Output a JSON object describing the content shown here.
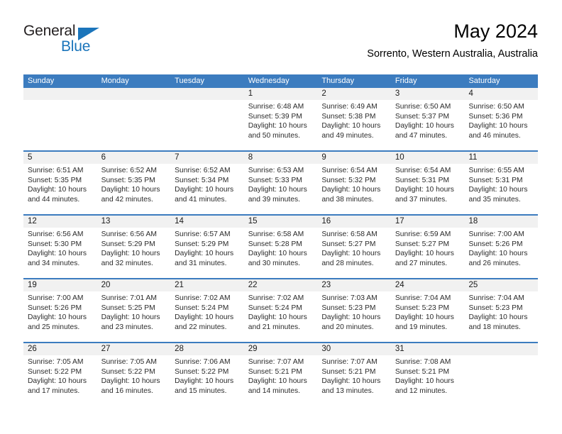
{
  "brand": {
    "name_part1": "General",
    "name_part2": "Blue",
    "triangle_color": "#1b75bb"
  },
  "header": {
    "title": "May 2024",
    "subtitle": "Sorrento, Western Australia, Australia"
  },
  "theme": {
    "header_blue": "#3c7cbf",
    "band_gray": "#f1f1f1",
    "text": "#2b2b2b"
  },
  "weekdays": [
    "Sunday",
    "Monday",
    "Tuesday",
    "Wednesday",
    "Thursday",
    "Friday",
    "Saturday"
  ],
  "weeks": [
    {
      "days": [
        {
          "num": "",
          "sunrise": "",
          "sunset": "",
          "daylight_line1": "",
          "daylight_line2": ""
        },
        {
          "num": "",
          "sunrise": "",
          "sunset": "",
          "daylight_line1": "",
          "daylight_line2": ""
        },
        {
          "num": "",
          "sunrise": "",
          "sunset": "",
          "daylight_line1": "",
          "daylight_line2": ""
        },
        {
          "num": "1",
          "sunrise": "Sunrise: 6:48 AM",
          "sunset": "Sunset: 5:39 PM",
          "daylight_line1": "Daylight: 10 hours",
          "daylight_line2": "and 50 minutes."
        },
        {
          "num": "2",
          "sunrise": "Sunrise: 6:49 AM",
          "sunset": "Sunset: 5:38 PM",
          "daylight_line1": "Daylight: 10 hours",
          "daylight_line2": "and 49 minutes."
        },
        {
          "num": "3",
          "sunrise": "Sunrise: 6:50 AM",
          "sunset": "Sunset: 5:37 PM",
          "daylight_line1": "Daylight: 10 hours",
          "daylight_line2": "and 47 minutes."
        },
        {
          "num": "4",
          "sunrise": "Sunrise: 6:50 AM",
          "sunset": "Sunset: 5:36 PM",
          "daylight_line1": "Daylight: 10 hours",
          "daylight_line2": "and 46 minutes."
        }
      ]
    },
    {
      "days": [
        {
          "num": "5",
          "sunrise": "Sunrise: 6:51 AM",
          "sunset": "Sunset: 5:35 PM",
          "daylight_line1": "Daylight: 10 hours",
          "daylight_line2": "and 44 minutes."
        },
        {
          "num": "6",
          "sunrise": "Sunrise: 6:52 AM",
          "sunset": "Sunset: 5:35 PM",
          "daylight_line1": "Daylight: 10 hours",
          "daylight_line2": "and 42 minutes."
        },
        {
          "num": "7",
          "sunrise": "Sunrise: 6:52 AM",
          "sunset": "Sunset: 5:34 PM",
          "daylight_line1": "Daylight: 10 hours",
          "daylight_line2": "and 41 minutes."
        },
        {
          "num": "8",
          "sunrise": "Sunrise: 6:53 AM",
          "sunset": "Sunset: 5:33 PM",
          "daylight_line1": "Daylight: 10 hours",
          "daylight_line2": "and 39 minutes."
        },
        {
          "num": "9",
          "sunrise": "Sunrise: 6:54 AM",
          "sunset": "Sunset: 5:32 PM",
          "daylight_line1": "Daylight: 10 hours",
          "daylight_line2": "and 38 minutes."
        },
        {
          "num": "10",
          "sunrise": "Sunrise: 6:54 AM",
          "sunset": "Sunset: 5:31 PM",
          "daylight_line1": "Daylight: 10 hours",
          "daylight_line2": "and 37 minutes."
        },
        {
          "num": "11",
          "sunrise": "Sunrise: 6:55 AM",
          "sunset": "Sunset: 5:31 PM",
          "daylight_line1": "Daylight: 10 hours",
          "daylight_line2": "and 35 minutes."
        }
      ]
    },
    {
      "days": [
        {
          "num": "12",
          "sunrise": "Sunrise: 6:56 AM",
          "sunset": "Sunset: 5:30 PM",
          "daylight_line1": "Daylight: 10 hours",
          "daylight_line2": "and 34 minutes."
        },
        {
          "num": "13",
          "sunrise": "Sunrise: 6:56 AM",
          "sunset": "Sunset: 5:29 PM",
          "daylight_line1": "Daylight: 10 hours",
          "daylight_line2": "and 32 minutes."
        },
        {
          "num": "14",
          "sunrise": "Sunrise: 6:57 AM",
          "sunset": "Sunset: 5:29 PM",
          "daylight_line1": "Daylight: 10 hours",
          "daylight_line2": "and 31 minutes."
        },
        {
          "num": "15",
          "sunrise": "Sunrise: 6:58 AM",
          "sunset": "Sunset: 5:28 PM",
          "daylight_line1": "Daylight: 10 hours",
          "daylight_line2": "and 30 minutes."
        },
        {
          "num": "16",
          "sunrise": "Sunrise: 6:58 AM",
          "sunset": "Sunset: 5:27 PM",
          "daylight_line1": "Daylight: 10 hours",
          "daylight_line2": "and 28 minutes."
        },
        {
          "num": "17",
          "sunrise": "Sunrise: 6:59 AM",
          "sunset": "Sunset: 5:27 PM",
          "daylight_line1": "Daylight: 10 hours",
          "daylight_line2": "and 27 minutes."
        },
        {
          "num": "18",
          "sunrise": "Sunrise: 7:00 AM",
          "sunset": "Sunset: 5:26 PM",
          "daylight_line1": "Daylight: 10 hours",
          "daylight_line2": "and 26 minutes."
        }
      ]
    },
    {
      "days": [
        {
          "num": "19",
          "sunrise": "Sunrise: 7:00 AM",
          "sunset": "Sunset: 5:26 PM",
          "daylight_line1": "Daylight: 10 hours",
          "daylight_line2": "and 25 minutes."
        },
        {
          "num": "20",
          "sunrise": "Sunrise: 7:01 AM",
          "sunset": "Sunset: 5:25 PM",
          "daylight_line1": "Daylight: 10 hours",
          "daylight_line2": "and 23 minutes."
        },
        {
          "num": "21",
          "sunrise": "Sunrise: 7:02 AM",
          "sunset": "Sunset: 5:24 PM",
          "daylight_line1": "Daylight: 10 hours",
          "daylight_line2": "and 22 minutes."
        },
        {
          "num": "22",
          "sunrise": "Sunrise: 7:02 AM",
          "sunset": "Sunset: 5:24 PM",
          "daylight_line1": "Daylight: 10 hours",
          "daylight_line2": "and 21 minutes."
        },
        {
          "num": "23",
          "sunrise": "Sunrise: 7:03 AM",
          "sunset": "Sunset: 5:23 PM",
          "daylight_line1": "Daylight: 10 hours",
          "daylight_line2": "and 20 minutes."
        },
        {
          "num": "24",
          "sunrise": "Sunrise: 7:04 AM",
          "sunset": "Sunset: 5:23 PM",
          "daylight_line1": "Daylight: 10 hours",
          "daylight_line2": "and 19 minutes."
        },
        {
          "num": "25",
          "sunrise": "Sunrise: 7:04 AM",
          "sunset": "Sunset: 5:23 PM",
          "daylight_line1": "Daylight: 10 hours",
          "daylight_line2": "and 18 minutes."
        }
      ]
    },
    {
      "days": [
        {
          "num": "26",
          "sunrise": "Sunrise: 7:05 AM",
          "sunset": "Sunset: 5:22 PM",
          "daylight_line1": "Daylight: 10 hours",
          "daylight_line2": "and 17 minutes."
        },
        {
          "num": "27",
          "sunrise": "Sunrise: 7:05 AM",
          "sunset": "Sunset: 5:22 PM",
          "daylight_line1": "Daylight: 10 hours",
          "daylight_line2": "and 16 minutes."
        },
        {
          "num": "28",
          "sunrise": "Sunrise: 7:06 AM",
          "sunset": "Sunset: 5:22 PM",
          "daylight_line1": "Daylight: 10 hours",
          "daylight_line2": "and 15 minutes."
        },
        {
          "num": "29",
          "sunrise": "Sunrise: 7:07 AM",
          "sunset": "Sunset: 5:21 PM",
          "daylight_line1": "Daylight: 10 hours",
          "daylight_line2": "and 14 minutes."
        },
        {
          "num": "30",
          "sunrise": "Sunrise: 7:07 AM",
          "sunset": "Sunset: 5:21 PM",
          "daylight_line1": "Daylight: 10 hours",
          "daylight_line2": "and 13 minutes."
        },
        {
          "num": "31",
          "sunrise": "Sunrise: 7:08 AM",
          "sunset": "Sunset: 5:21 PM",
          "daylight_line1": "Daylight: 10 hours",
          "daylight_line2": "and 12 minutes."
        },
        {
          "num": "",
          "sunrise": "",
          "sunset": "",
          "daylight_line1": "",
          "daylight_line2": ""
        }
      ]
    }
  ]
}
